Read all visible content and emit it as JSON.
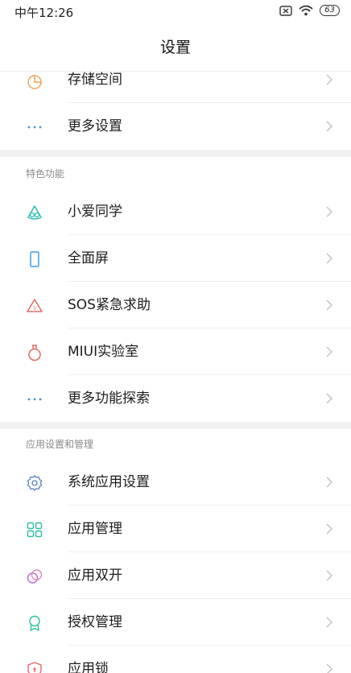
{
  "status_bar": {
    "time": "中午12:26",
    "battery": "63"
  },
  "header": {
    "title": "设置"
  },
  "top_items": [
    {
      "label": "存储空间",
      "icon": "storage-pie-icon",
      "color": "#f0a354"
    },
    {
      "label": "更多设置",
      "icon": "more-dots-icon",
      "color": "#4a90d9"
    }
  ],
  "sections": [
    {
      "title": "特色功能",
      "items": [
        {
          "label": "小爱同学",
          "icon": "xiaoai-icon",
          "color": "#2dbfb5"
        },
        {
          "label": "全面屏",
          "icon": "fullscreen-phone-icon",
          "color": "#3c9ee3"
        },
        {
          "label": "SOS紧急求助",
          "icon": "sos-icon",
          "color": "#e36a6a"
        },
        {
          "label": "MIUI实验室",
          "icon": "lab-flask-icon",
          "color": "#e36a6a"
        },
        {
          "label": "更多功能探索",
          "icon": "more-dots-icon",
          "color": "#4a90d9"
        }
      ]
    },
    {
      "title": "应用设置和管理",
      "items": [
        {
          "label": "系统应用设置",
          "icon": "gear-icon",
          "color": "#5a7fbf"
        },
        {
          "label": "应用管理",
          "icon": "app-grid-icon",
          "color": "#2dbfa0"
        },
        {
          "label": "应用双开",
          "icon": "dual-app-icon",
          "color": "#b36bd6"
        },
        {
          "label": "授权管理",
          "icon": "badge-icon",
          "color": "#2dbfa0"
        },
        {
          "label": "应用锁",
          "icon": "lock-shield-icon",
          "color": "#e36a6a"
        }
      ]
    }
  ]
}
